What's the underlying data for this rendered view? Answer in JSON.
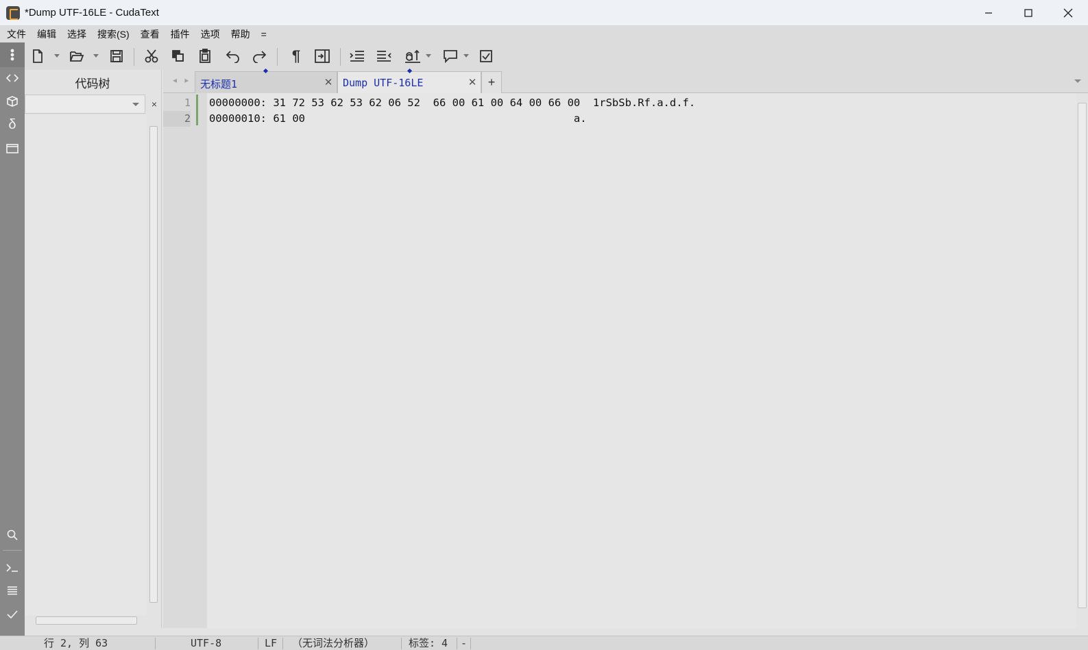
{
  "window": {
    "title": "*Dump UTF-16LE - CudaText",
    "minimize_glyph": "—",
    "maximize_glyph": "☐",
    "close_glyph": "✕"
  },
  "menu": {
    "items": [
      "文件",
      "编辑",
      "选择",
      "搜索(S)",
      "查看",
      "插件",
      "选项",
      "帮助",
      "="
    ]
  },
  "activity_bar": {
    "icons": [
      "more-vertical-icon",
      "code-tree-icon",
      "project-icon",
      "delta-icon",
      "tabs-icon",
      "search-icon",
      "console-icon",
      "output-list-icon",
      "validate-check-icon"
    ]
  },
  "toolbar": {
    "buttons": [
      "new-file",
      "open-file",
      "save",
      "cut",
      "copy",
      "paste",
      "undo",
      "redo",
      "unprinted-chars",
      "wrap",
      "indent",
      "unindent",
      "case",
      "comment",
      "check"
    ]
  },
  "side_panel": {
    "title": "代码树",
    "close_glyph": "×"
  },
  "tabs": {
    "nav_glyph": "◂ ▸",
    "items": [
      {
        "label": "无标题1",
        "close_glyph": "✕",
        "active": false
      },
      {
        "label": "Dump UTF-16LE",
        "close_glyph": "✕",
        "active": true
      }
    ],
    "add_glyph": "+"
  },
  "editor": {
    "lines": [
      {
        "number": "1",
        "text": "00000000: 31 72 53 62 53 62 06 52  66 00 61 00 64 00 66 00  1rSbSb.Rf.a.d.f."
      },
      {
        "number": "2",
        "text": "00000010: 61 00                                          a."
      }
    ],
    "current_line": 2
  },
  "status_bar": {
    "position": "行 2, 列 63",
    "encoding": "UTF-8",
    "line_ending": "LF",
    "lexer": "（无词法分析器）",
    "tab_size": "标签: 4",
    "extra": "-"
  },
  "colors": {
    "tab_text": "#1a2fb0",
    "modified_gutter": "#7aa66b",
    "activity_bar": "#888888",
    "app_icon_accent": "#f3a53a"
  }
}
